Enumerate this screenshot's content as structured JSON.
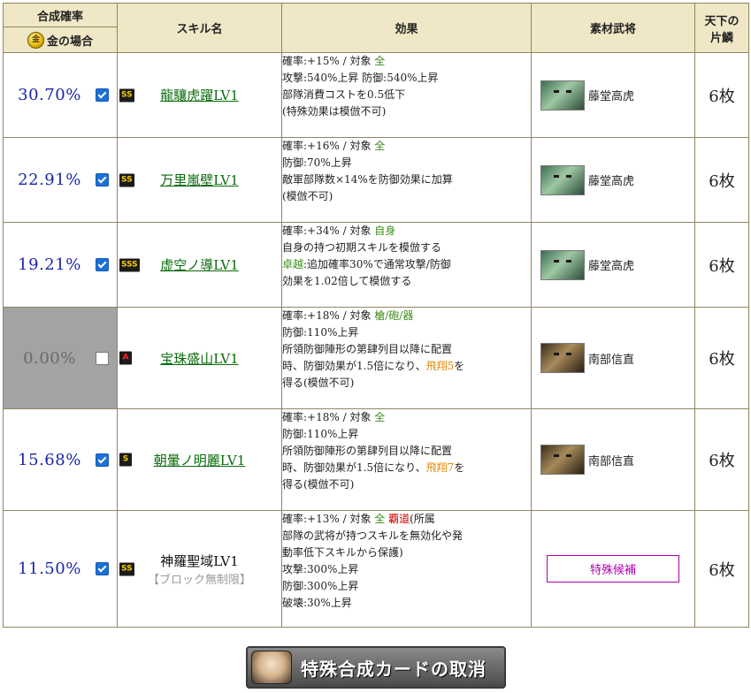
{
  "header": {
    "rate_title": "合成確率",
    "gold_case": "金の場合",
    "gold_icon_char": "金",
    "skill_col": "スキル名",
    "effect_col": "効果",
    "material_col": "素材武将",
    "count_col_line1": "天下の",
    "count_col_line2": "片鱗"
  },
  "rows": [
    {
      "rate": "30.70%",
      "checked": true,
      "rank": "SS",
      "skill": "龍驤虎躍LV1",
      "skill_linked": true,
      "effect_lines": [
        [
          {
            "t": "確率:+15% / 対象 "
          },
          {
            "t": "全",
            "c": "g"
          }
        ],
        [
          {
            "t": "攻撃:540%上昇 防御:540%上昇"
          }
        ],
        [
          {
            "t": "部隊消費コストを0.5低下"
          }
        ],
        [
          {
            "t": "(特殊効果は模倣不可)"
          }
        ]
      ],
      "material": "藤堂高虎",
      "portrait": "green",
      "count": "6枚"
    },
    {
      "rate": "22.91%",
      "checked": true,
      "rank": "SS",
      "skill": "万里嵐壁LV1",
      "skill_linked": true,
      "effect_lines": [
        [
          {
            "t": "確率:+16% / 対象 "
          },
          {
            "t": "全",
            "c": "g"
          }
        ],
        [
          {
            "t": "防御:70%上昇"
          }
        ],
        [
          {
            "t": "敵軍部隊数×14%を防御効果に加算"
          }
        ],
        [
          {
            "t": "(模倣不可)"
          }
        ]
      ],
      "material": "藤堂高虎",
      "portrait": "green",
      "count": "6枚"
    },
    {
      "rate": "19.21%",
      "checked": true,
      "rank": "SSS",
      "skill": "虚空ノ導LV1",
      "skill_linked": true,
      "effect_lines": [
        [
          {
            "t": "確率:+34% / 対象 "
          },
          {
            "t": "自身",
            "c": "g"
          }
        ],
        [
          {
            "t": "自身の持つ初期スキルを模倣する"
          }
        ],
        [
          {
            "t": "卓越",
            "c": "g"
          },
          {
            "t": ":追加確率30%で通常攻撃/防御"
          }
        ],
        [
          {
            "t": "効果を1.02倍して模倣する"
          }
        ]
      ],
      "material": "藤堂高虎",
      "portrait": "green",
      "count": "6枚"
    },
    {
      "rate": "0.00%",
      "checked": false,
      "rank": "A",
      "disabled": true,
      "skill": "宝珠盛山LV1",
      "skill_linked": true,
      "effect_lines": [
        [
          {
            "t": "確率:+18% / 対象 "
          },
          {
            "t": "槍/砲/器",
            "c": "g"
          }
        ],
        [
          {
            "t": "防御:110%上昇"
          }
        ],
        [
          {
            "t": "所領防御陣形の第肆列目以降に配置"
          }
        ],
        [
          {
            "t": "時、防御効果が1.5倍になり、"
          },
          {
            "t": "飛翔5",
            "c": "o"
          },
          {
            "t": "を"
          }
        ],
        [
          {
            "t": "得る(模倣不可)"
          }
        ]
      ],
      "material": "南部信直",
      "portrait": "brown",
      "count": "6枚"
    },
    {
      "rate": "15.68%",
      "checked": true,
      "rank": "S",
      "skill": "朝暈ノ明麗LV1",
      "skill_linked": true,
      "effect_lines": [
        [
          {
            "t": "確率:+18% / 対象 "
          },
          {
            "t": "全",
            "c": "g"
          }
        ],
        [
          {
            "t": "防御:110%上昇"
          }
        ],
        [
          {
            "t": "所領防御陣形の第肆列目以降に配置"
          }
        ],
        [
          {
            "t": "時、防御効果が1.5倍になり、"
          },
          {
            "t": "飛翔7",
            "c": "o"
          },
          {
            "t": "を"
          }
        ],
        [
          {
            "t": "得る(模倣不可)"
          }
        ]
      ],
      "material": "南部信直",
      "portrait": "brown",
      "count": "6枚"
    },
    {
      "rate": "11.50%",
      "checked": true,
      "rank": "SS",
      "skill": "神羅聖域LV1",
      "skill_linked": false,
      "skill_sub": "【ブロック無制限】",
      "effect_lines": [
        [
          {
            "t": "確率:+13% / 対象 "
          },
          {
            "t": "全",
            "c": "g"
          },
          {
            "t": " "
          },
          {
            "t": "覇道",
            "c": "r"
          },
          {
            "t": "(所属"
          }
        ],
        [
          {
            "t": "部隊の武将が持つスキルを無効化や発"
          }
        ],
        [
          {
            "t": "動率低下スキルから保護)"
          }
        ],
        [
          {
            "t": "攻撃:300%上昇"
          }
        ],
        [
          {
            "t": "防御:300%上昇"
          }
        ],
        [
          {
            "t": "破壊:30%上昇"
          }
        ]
      ],
      "material_special": "特殊候補",
      "count": "6枚"
    }
  ],
  "footer": {
    "cancel_label": "特殊合成カードの取消"
  }
}
